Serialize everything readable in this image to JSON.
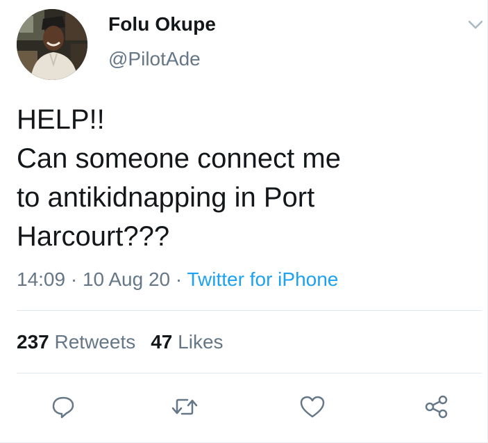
{
  "author": {
    "display_name": "Folu Okupe",
    "handle": "@PilotAde"
  },
  "tweet": {
    "text": "HELP!!\nCan someone connect me\nto antikidnapping in Port\nHarcourt???",
    "time": "14:09",
    "separator": "·",
    "date": "10 Aug 20",
    "source": "Twitter for iPhone"
  },
  "stats": {
    "retweets_count": "237",
    "retweets_label": "Retweets",
    "likes_count": "47",
    "likes_label": "Likes"
  },
  "icons": {
    "menu": "chevron-down-icon",
    "reply": "reply-icon",
    "retweet": "retweet-icon",
    "like": "heart-icon",
    "share": "share-icon"
  },
  "colors": {
    "text": "#14171a",
    "secondary": "#657786",
    "link": "#1da1f2",
    "divider": "#e1e8ed"
  }
}
